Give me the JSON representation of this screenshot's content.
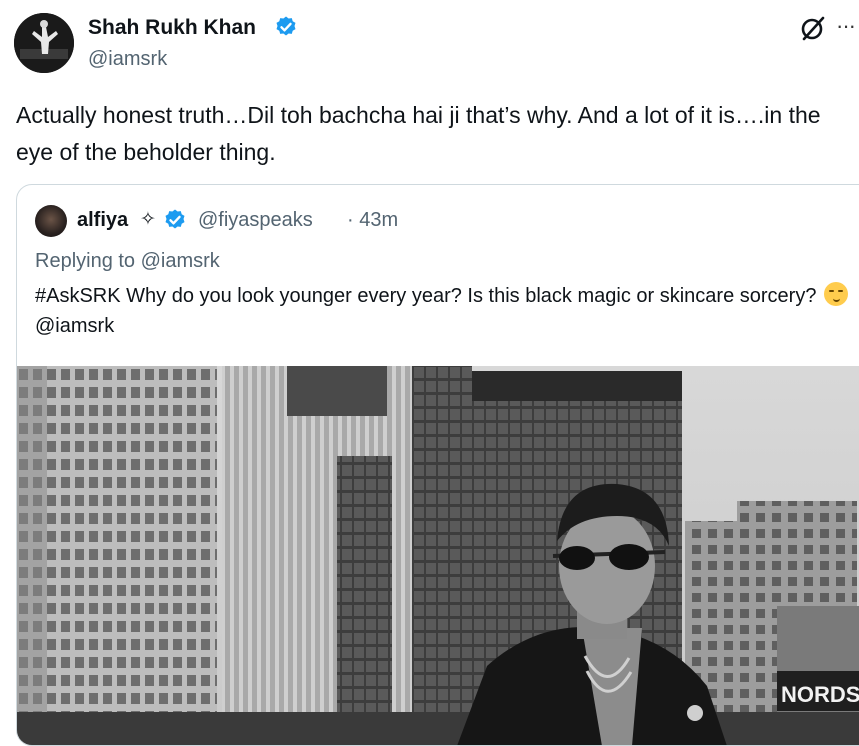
{
  "tweet": {
    "author": {
      "name": "Shah Rukh Khan",
      "handle": "@iamsrk",
      "verified": true
    },
    "text": "Actually honest truth…Dil toh bachcha hai ji that’s why. And a  lot of it is….in the eye of the beholder thing.",
    "icons": {
      "grok": "grok-icon",
      "more": "more-icon"
    },
    "more_glyph": "···"
  },
  "quoted_tweet": {
    "author": {
      "name": "alfiya",
      "sparkle": "✧",
      "handle": "@fiyaspeaks",
      "verified": true
    },
    "time": "· 43m",
    "replying_to": "Replying to @iamsrk",
    "text_before_emoji": "#AskSRK Why do you look younger every year? Is this black magic or skincare sorcery?",
    "text_after_emoji": "@iamsrk",
    "image": {
      "storefront_sign": "NORDST"
    }
  },
  "colors": {
    "text_primary": "#0f1419",
    "text_secondary": "#536471",
    "verified_blue": "#1d9bf0",
    "border": "#cfd9de"
  }
}
